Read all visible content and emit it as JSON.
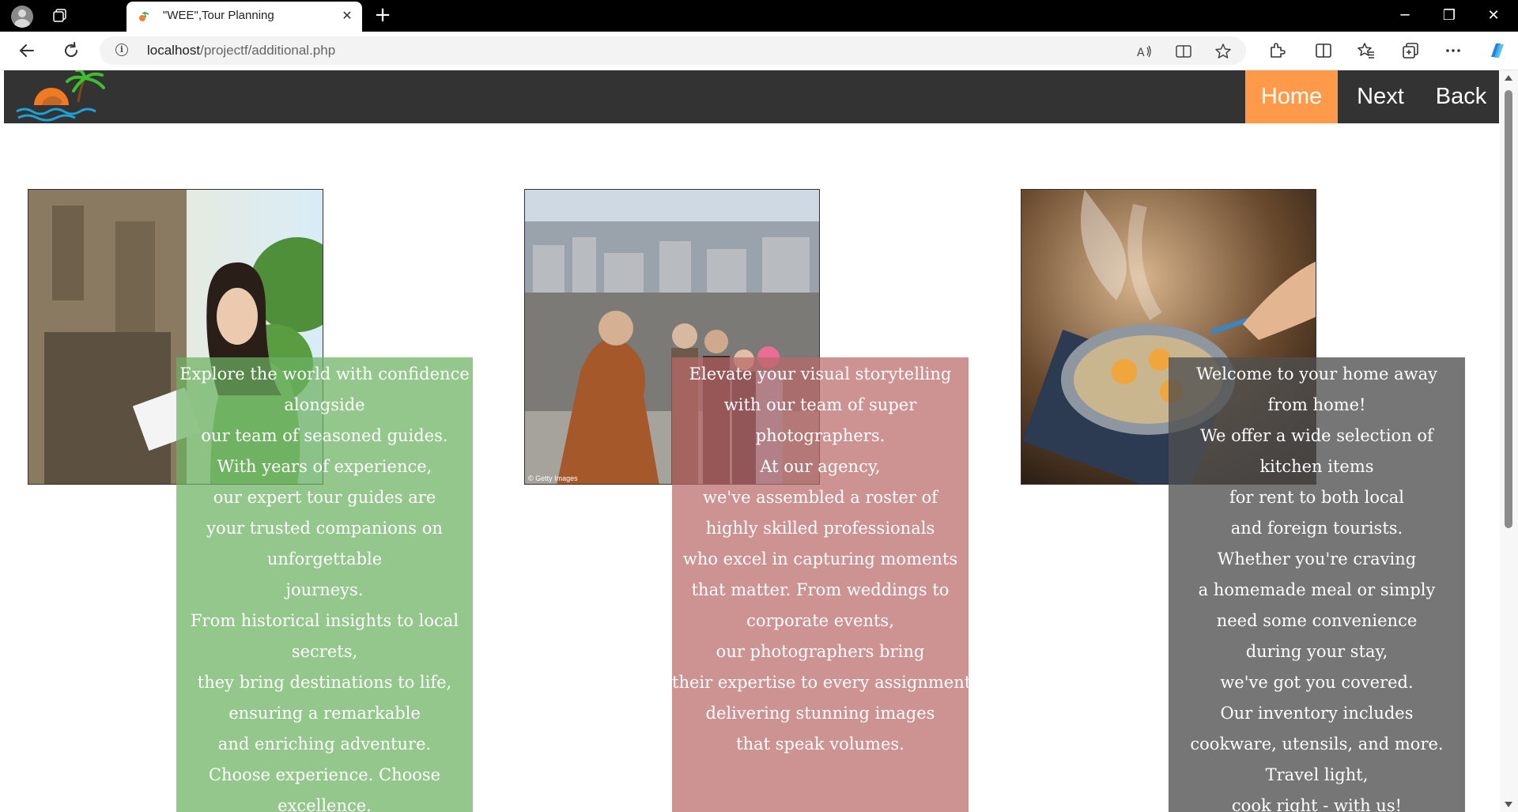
{
  "browser": {
    "tab_title": "\"WEE\",Tour Planning",
    "url_host": "localhost",
    "url_path": "/projectf/additional.php"
  },
  "nav": {
    "home": "Home",
    "next": "Next",
    "back": "Back"
  },
  "cards": [
    {
      "lines": [
        "Explore the world with confidence",
        "alongside",
        "our team of seasoned guides.",
        "With years of experience,",
        "our expert tour guides are",
        "your trusted companions on",
        "unforgettable",
        "journeys.",
        "From historical insights to local",
        "secrets,",
        "they bring destinations to life,",
        "ensuring a remarkable",
        "and enriching adventure.",
        "Choose experience. Choose",
        "excellence."
      ]
    },
    {
      "photo_caption": "© Getty Images",
      "lines": [
        "Elevate your visual storytelling",
        "with our team of super",
        "photographers.",
        "At our agency,",
        "we've assembled a roster of",
        "highly skilled professionals",
        "who excel in capturing moments",
        "that matter. From weddings to",
        "corporate events,",
        "our photographers bring",
        "their expertise to every assignment,",
        "delivering stunning images",
        "that speak volumes."
      ]
    },
    {
      "lines": [
        "Welcome to your home away",
        "from home!",
        "We offer a wide selection of",
        "kitchen items",
        "for rent to both local",
        "and foreign tourists.",
        "Whether you're craving",
        "a homemade meal or simply",
        "need some convenience",
        "during your stay,",
        "we've got you covered.",
        "Our inventory includes",
        "cookware, utensils, and more.",
        "Travel light,",
        "cook right - with us!"
      ]
    }
  ],
  "colors": {
    "nav_bg": "#333333",
    "home_accent": "#ff9a4a",
    "card1": "#6bb260",
    "card2": "#ba6868",
    "card3": "#505050"
  }
}
